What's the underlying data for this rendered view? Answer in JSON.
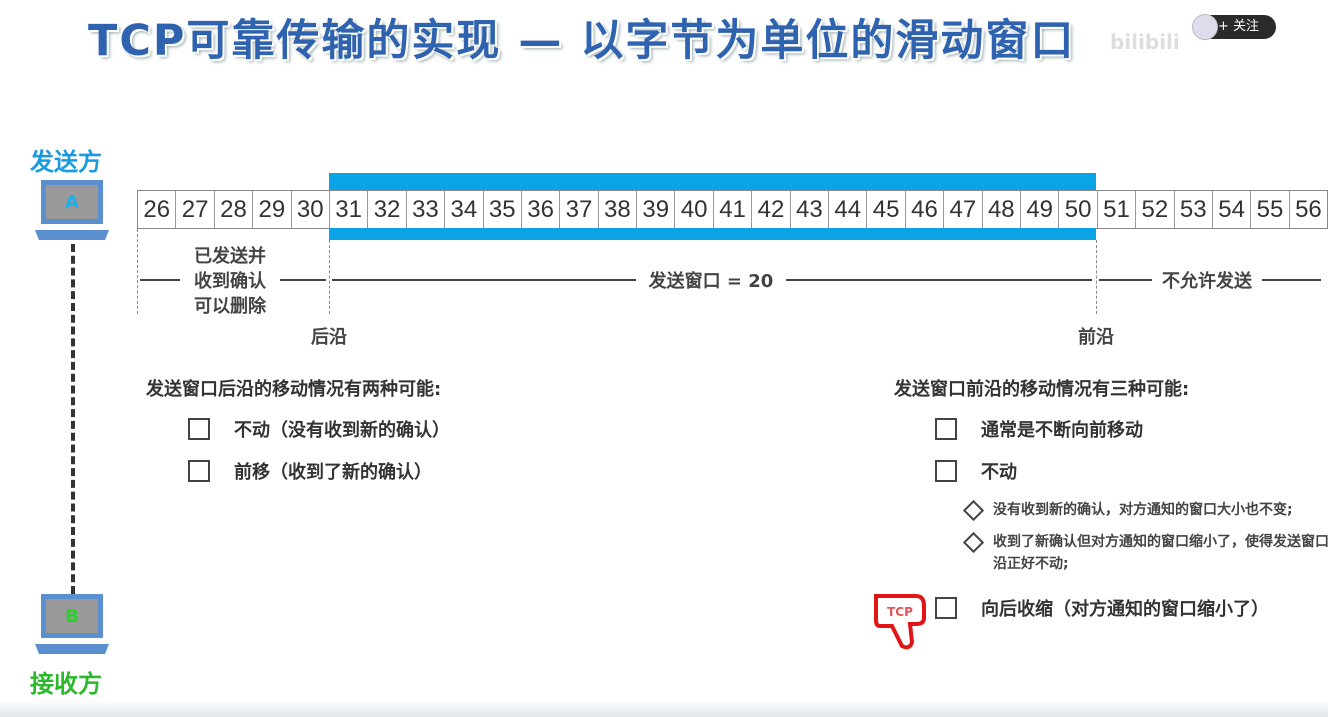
{
  "title": "TCP可靠传输的实现 — 以字节为单位的滑动窗口",
  "overlay": {
    "follow_label": "+ 关注",
    "watermark": "bilibili"
  },
  "sender": {
    "label": "发送方",
    "host": "A"
  },
  "receiver": {
    "label": "接收方",
    "host": "B"
  },
  "bytes": [
    "26",
    "27",
    "28",
    "29",
    "30",
    "31",
    "32",
    "33",
    "34",
    "35",
    "36",
    "37",
    "38",
    "39",
    "40",
    "41",
    "42",
    "43",
    "44",
    "45",
    "46",
    "47",
    "48",
    "49",
    "50",
    "51",
    "52",
    "53",
    "54",
    "55",
    "56"
  ],
  "window_range": {
    "start": "31",
    "end": "50",
    "size": 20
  },
  "regions": {
    "acked": "已发送并\n收到确认\n可以删除",
    "window": "发送窗口 = 20",
    "disallowed": "不允许发送"
  },
  "edges": {
    "trailing": "后沿",
    "leading": "前沿"
  },
  "left_section": {
    "heading": "发送窗口后沿的移动情况有两种可能:",
    "items": [
      "不动（没有收到新的确认）",
      "前移（收到了新的确认）"
    ]
  },
  "right_section": {
    "heading": "发送窗口前沿的移动情况有三种可能:",
    "items": [
      "通常是不断向前移动",
      "不动",
      "向后收缩（对方通知的窗口缩小了）"
    ],
    "sub_items": [
      "没有收到新的确认，对方通知的窗口大小也不变;",
      "收到了新确认但对方通知的窗口缩小了，使得发送窗口前沿正好不动;"
    ]
  },
  "badge": {
    "text": "TCP"
  },
  "colors": {
    "title": "#2f63b0",
    "window_bar": "#0aa3e6",
    "sender": "#1a9be0",
    "receiver": "#2bb82b",
    "badge": "#e01515"
  }
}
